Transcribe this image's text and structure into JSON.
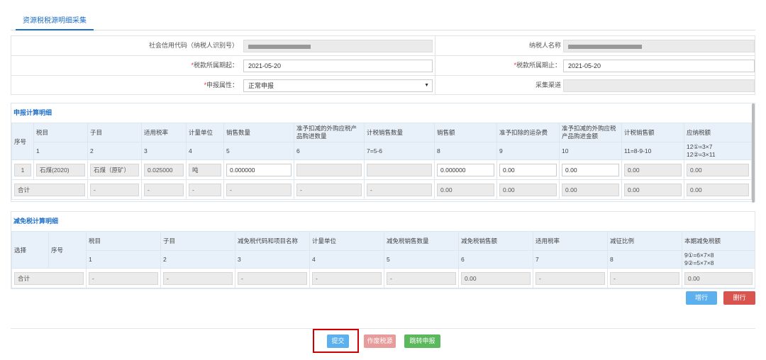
{
  "tab": {
    "label": "资源税税源明细采集"
  },
  "header": {
    "credit_code_label": "社会信用代码（纳税人识别号）",
    "taxpayer_name_label": "纳税人名称",
    "period_start_label": "税款所属期起：",
    "period_start_value": "2021-05-20",
    "period_end_label": "税款所属期止：",
    "period_end_value": "2021-05-20",
    "declare_attr_label": "申报属性：",
    "declare_attr_value": "正常申报",
    "channel_label": "采集渠道"
  },
  "calc_section": {
    "title": "申报计算明细",
    "headers": [
      "序号",
      "税目",
      "子目",
      "适用税率",
      "计量单位",
      "销售数量",
      "准予扣减的外购应税产品购进数量",
      "计税销售数量",
      "销售额",
      "准予扣除的运杂费",
      "准予扣减的外购应税产品购进金额",
      "计税销售额",
      "应纳税额"
    ],
    "formulas": [
      "1",
      "2",
      "3",
      "4",
      "5",
      "6",
      "7=5-6",
      "8",
      "9",
      "10",
      "11=8-9-10",
      "12①=3×7",
      "12②=3×11"
    ],
    "row": [
      "1",
      "石煤(2020)",
      "石煤（原矿）",
      "0.025000",
      "吨",
      "0.000000",
      "",
      "",
      "0.000000",
      "0.00",
      "0.00",
      "0.00",
      "0.00"
    ],
    "total": [
      "合计",
      "-",
      "-",
      "-",
      "-",
      "-",
      "-",
      "0.00",
      "0.00",
      "0.00",
      "0.00",
      "0.00"
    ]
  },
  "relief_section": {
    "title": "减免税计算明细",
    "headers": [
      "选择",
      "序号",
      "税目",
      "子目",
      "减免税代码和项目名称",
      "计量单位",
      "减免税销售数量",
      "减免税销售额",
      "适用税率",
      "减征比例",
      "本期减免税额"
    ],
    "formulas": [
      "1",
      "2",
      "3",
      "4",
      "5",
      "6",
      "7",
      "8",
      "9①=6×7×8",
      "9②=5×7×8"
    ],
    "total": [
      "合计",
      "-",
      "-",
      "-",
      "-",
      "-",
      "0.00",
      "-",
      "-",
      "0.00"
    ],
    "add_row": "增行",
    "delete_row": "删行"
  },
  "footer": {
    "submit": "提交",
    "void": "作废税源",
    "goto": "跳转申报"
  },
  "colors": {
    "accent": "#1e6fc7",
    "add": "#5cb0ee",
    "delete": "#d9534f",
    "void": "#e89b9b",
    "goto": "#5cb85c",
    "highlight": "#cc0000"
  }
}
